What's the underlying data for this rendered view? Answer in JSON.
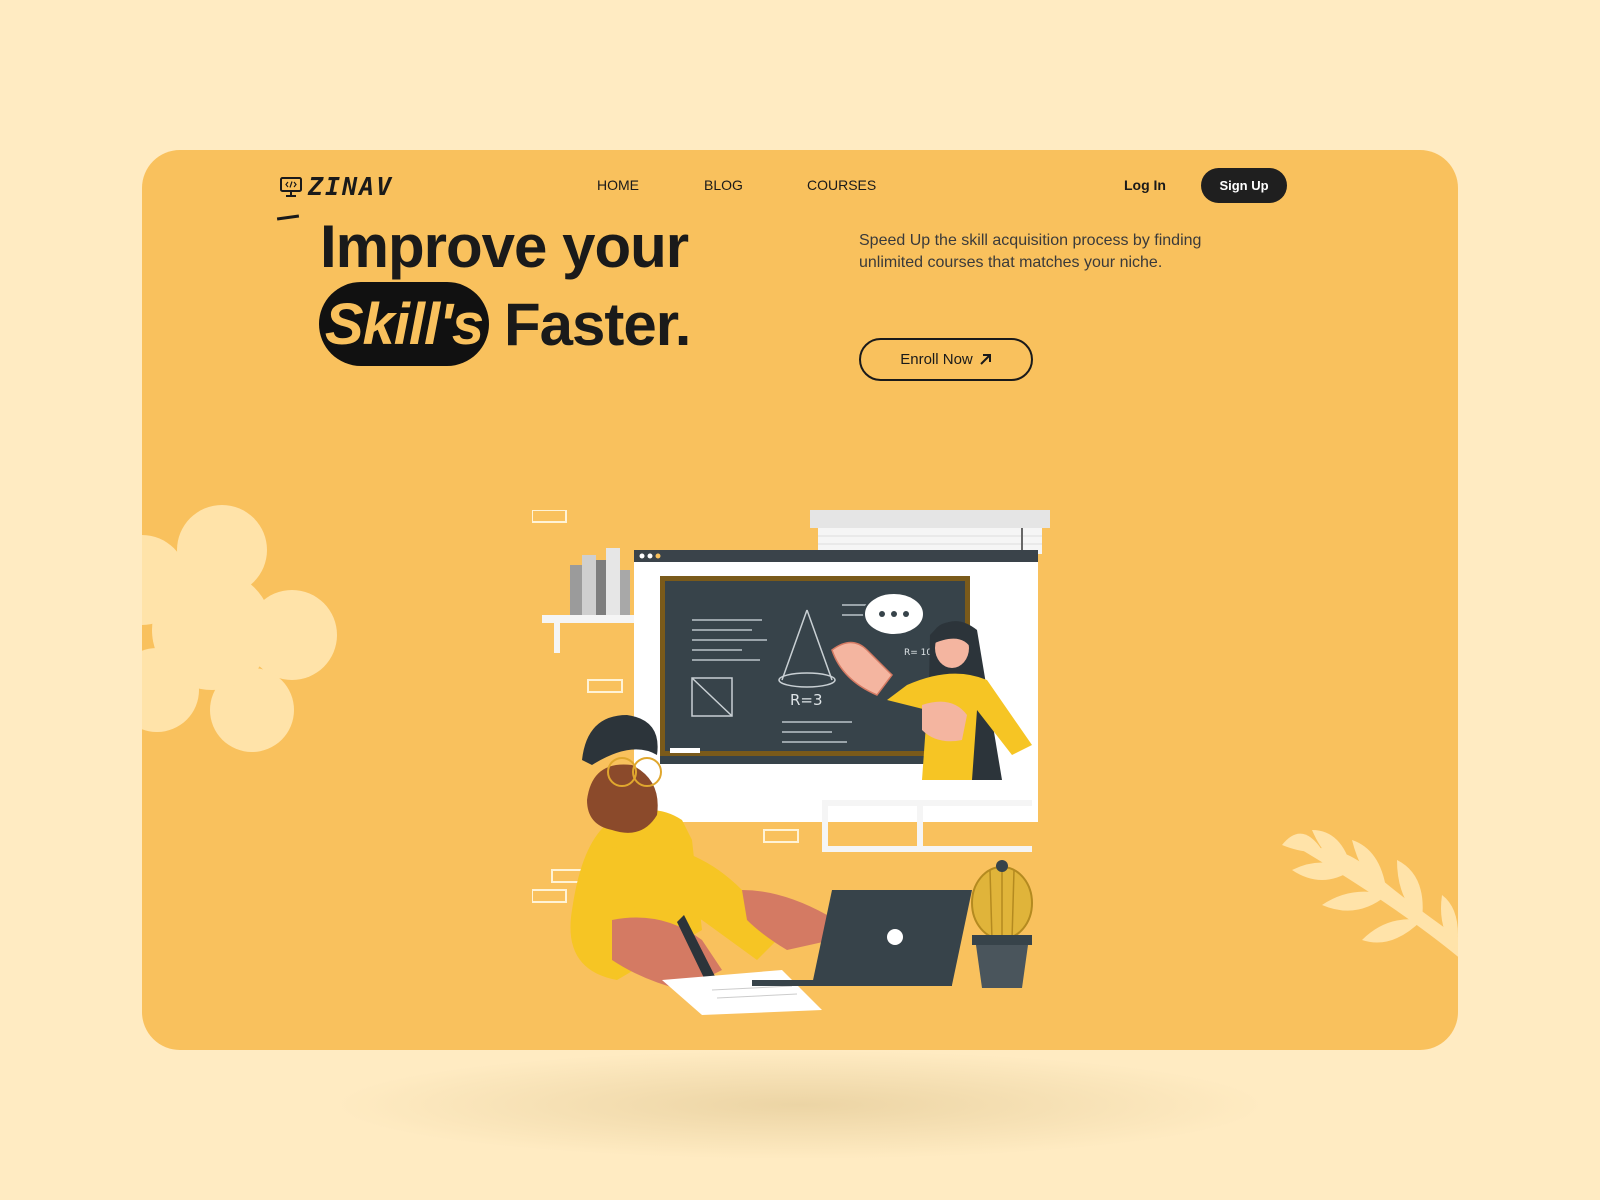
{
  "brand": {
    "name": "ZINAV",
    "icon": "monitor-code-icon"
  },
  "nav": {
    "items": [
      "HOME",
      "BLOG",
      "COURSES"
    ]
  },
  "auth": {
    "login": "Log In",
    "signup": "Sign Up"
  },
  "hero": {
    "line1": "Improve your",
    "highlight": "Skill's",
    "line2": "Faster.",
    "description": "Speed Up the skill acquisition process by finding unlimited courses that matches your niche.",
    "cta": "Enroll Now",
    "cta_icon": "arrow-up-right-icon"
  },
  "illustration": {
    "board_label": "R=3",
    "board_note": "R= 10",
    "board_h": "h"
  },
  "colors": {
    "page_bg": "#FFEBC2",
    "card_bg": "#F9C15D",
    "dark": "#1F1F1F"
  }
}
